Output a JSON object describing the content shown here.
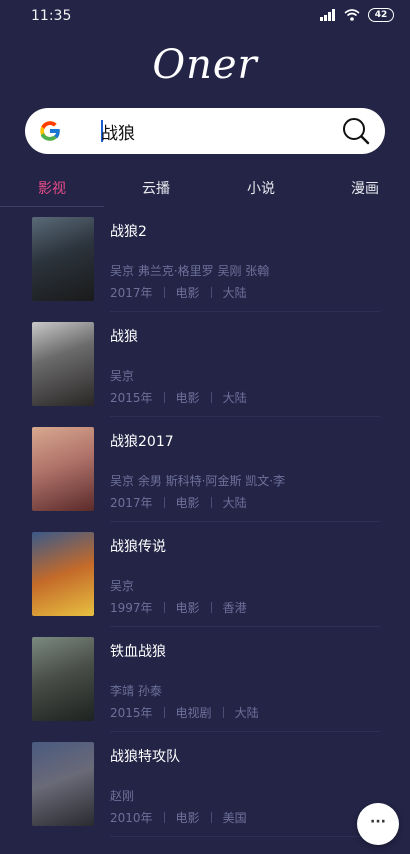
{
  "status": {
    "time": "11:35",
    "battery": "42"
  },
  "app": {
    "logo": "Oner"
  },
  "search": {
    "value": "战狼"
  },
  "tabs": [
    {
      "label": "影视",
      "active": true
    },
    {
      "label": "云播",
      "active": false
    },
    {
      "label": "小说",
      "active": false
    },
    {
      "label": "漫画",
      "active": false
    }
  ],
  "results": [
    {
      "title": "战狼2",
      "cast": "吴京 弗兰克·格里罗 吴刚 张翰",
      "year": "2017年",
      "type": "电影",
      "region": "大陆"
    },
    {
      "title": "战狼",
      "cast": "吴京",
      "year": "2015年",
      "type": "电影",
      "region": "大陆"
    },
    {
      "title": "战狼2017",
      "cast": "吴京 余男 斯科特·阿金斯 凯文·李",
      "year": "2017年",
      "type": "电影",
      "region": "大陆"
    },
    {
      "title": "战狼传说",
      "cast": "吴京",
      "year": "1997年",
      "type": "电影",
      "region": "香港"
    },
    {
      "title": "铁血战狼",
      "cast": "李靖 孙泰",
      "year": "2015年",
      "type": "电视剧",
      "region": "大陆"
    },
    {
      "title": "战狼特攻队",
      "cast": "赵刚",
      "year": "2010年",
      "type": "电影",
      "region": "美国"
    }
  ],
  "fab": {
    "label": "···"
  },
  "colors": {
    "background": "#232446",
    "accent": "#e84b8a",
    "muted": "#6d7099"
  }
}
